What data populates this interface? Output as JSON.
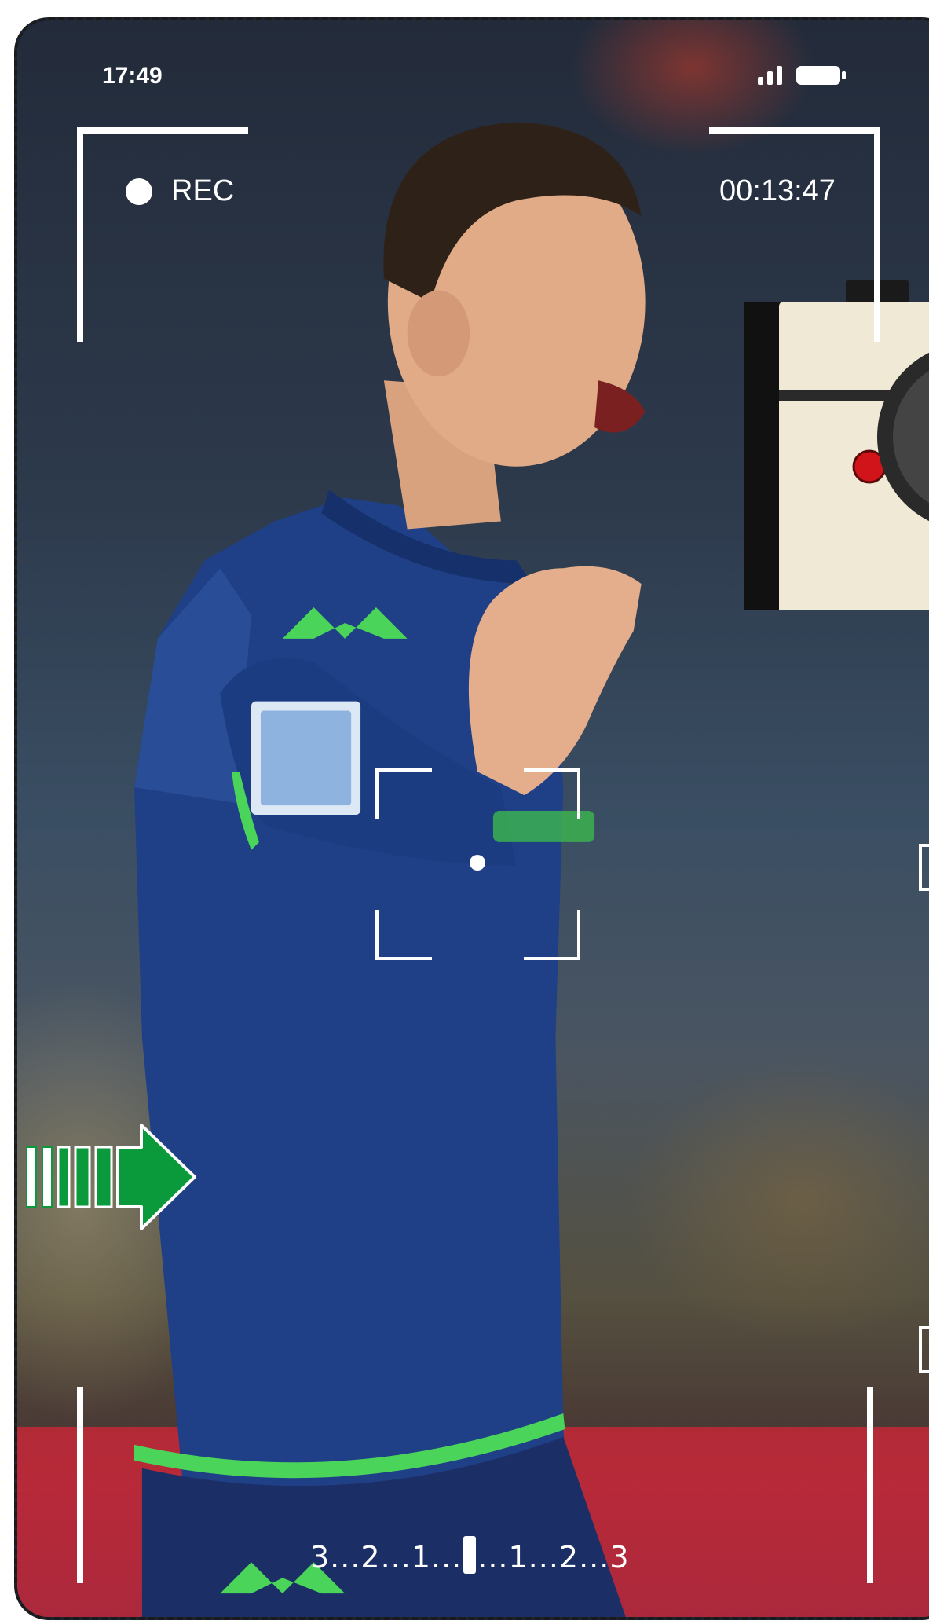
{
  "status_bar": {
    "time": "17:49",
    "signal_icon": "signal-bars-icon",
    "battery_icon": "battery-icon"
  },
  "recorder": {
    "rec_label": "REC",
    "elapsed": "00:13:47"
  },
  "exposure_scale": {
    "left": "3...2...1...",
    "right": "...1...2...3"
  },
  "colors": {
    "overlay": "#ffffff",
    "arrow": "#0a9a3c",
    "camera_body": "#efe9d6",
    "camera_button": "#d0141a",
    "jersey": "#1f3f86",
    "trim": "#4bd45a"
  },
  "icons": [
    "record-dot-icon",
    "focus-bracket-icon",
    "forward-arrow-icon",
    "camera-icon"
  ]
}
